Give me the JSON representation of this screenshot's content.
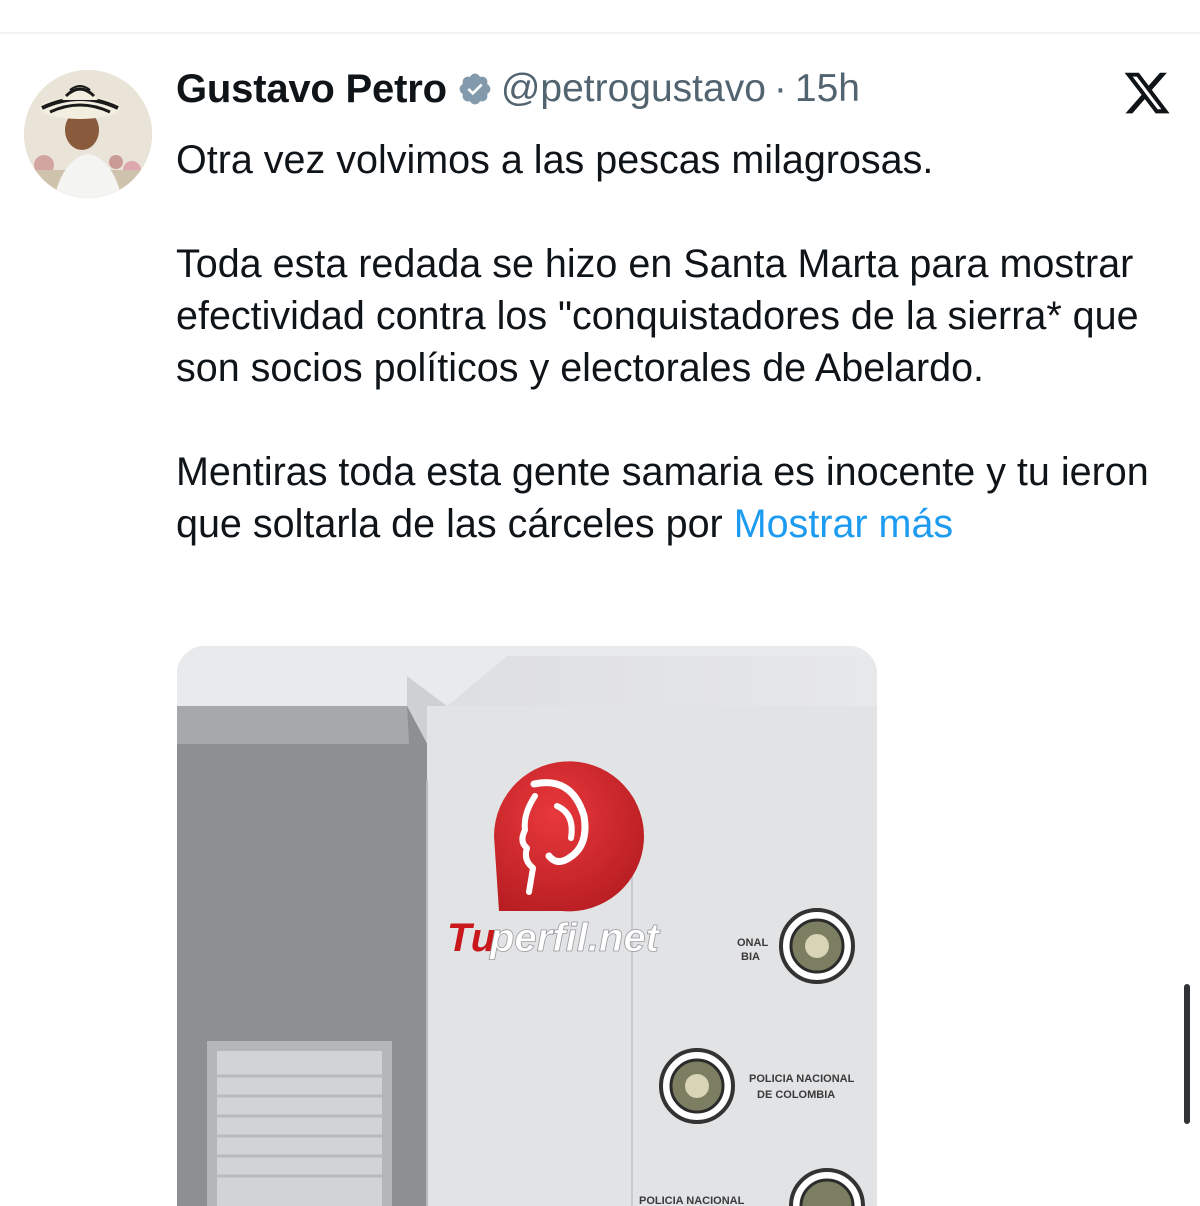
{
  "tweet": {
    "author_name": "Gustavo Petro",
    "handle": "@petrogustavo",
    "separator": "·",
    "time": "15h",
    "paragraphs": [
      "Otra vez volvimos a las pescas milagrosas.",
      "Toda esta redada se hizo en Santa Marta para mostrar efectividad contra los \"conquistadores de la sierra* que son socios políticos y electorales de Abelardo.",
      "Mentiras toda esta gente samaria es inocente y tu ieron que soltarla de las cárceles por "
    ],
    "show_more": "Mostrar más",
    "media": {
      "logo_text_a": "Tu",
      "logo_text_b": "perfil.net",
      "badge_lines": [
        "POLICIA NACIONAL",
        "DE COLOMBIA"
      ],
      "badge_partial_a": "ONAL",
      "badge_partial_b": "BIA",
      "badge_bottom": "POLICIA NACIONAL"
    }
  },
  "icons": {
    "verified": "verified-badge-icon",
    "platform": "x-logo-icon"
  },
  "colors": {
    "accent": "#1d9bf0",
    "secondary_text": "#536471",
    "primary_text": "#0f1419",
    "logo_red": "#d4262b"
  }
}
